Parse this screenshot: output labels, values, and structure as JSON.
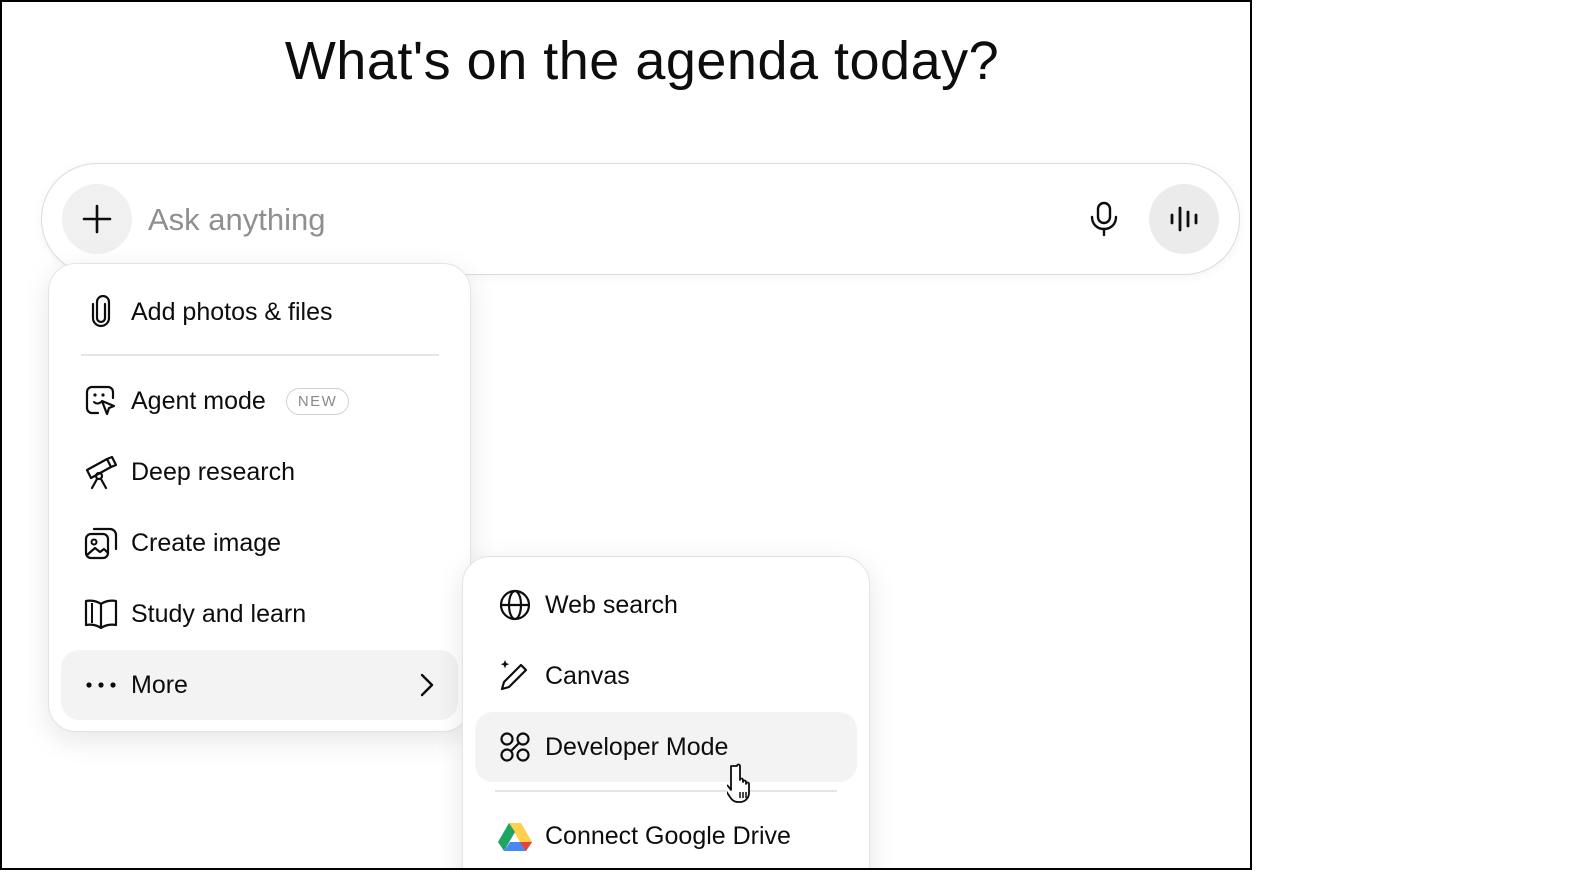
{
  "heading": "What's on the agenda today?",
  "composer": {
    "placeholder": "Ask anything",
    "plus_icon": "plus-icon",
    "mic_icon": "microphone-icon",
    "voice_icon": "voice-waveform-icon"
  },
  "menu": {
    "items": [
      {
        "label": "Add photos & files",
        "icon": "paperclip-icon"
      },
      {
        "label": "Agent mode",
        "icon": "agent-cursor-icon",
        "badge": "NEW"
      },
      {
        "label": "Deep research",
        "icon": "telescope-icon"
      },
      {
        "label": "Create image",
        "icon": "image-create-icon"
      },
      {
        "label": "Study and learn",
        "icon": "book-icon"
      },
      {
        "label": "More",
        "icon": "more-dots-icon",
        "chevron": "chevron-right-icon"
      }
    ]
  },
  "submenu": {
    "items": [
      {
        "label": "Web search",
        "icon": "globe-icon"
      },
      {
        "label": "Canvas",
        "icon": "pen-sparkle-icon"
      },
      {
        "label": "Developer Mode",
        "icon": "nodes-icon"
      },
      {
        "label": "Connect Google Drive",
        "icon": "google-drive-icon"
      }
    ]
  },
  "colors": {
    "text": "#0d0d0d",
    "placeholder": "#8f8f8f",
    "hover_bg": "#f3f3f3",
    "button_bg": "#f0f0f0",
    "drive_green": "#1fa463",
    "drive_yellow": "#ffd04b",
    "drive_blue": "#4688f4",
    "drive_red": "#e94235"
  }
}
